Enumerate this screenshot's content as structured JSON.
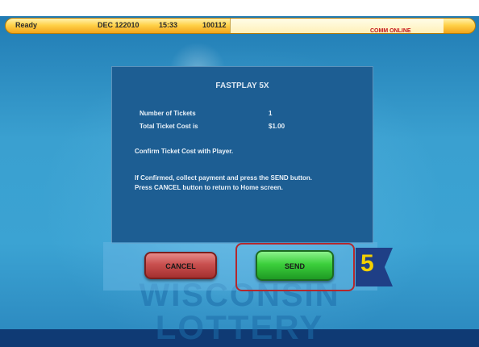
{
  "status_bar": {
    "ready": "Ready",
    "date": "DEC 122010",
    "time": "15:33",
    "code": "100112",
    "comm": "COMM ONLINE"
  },
  "dialog": {
    "title": "FASTPLAY 5X",
    "rows": [
      {
        "label": "Number of Tickets",
        "value": "1"
      },
      {
        "label": "Total Ticket Cost is",
        "value": "$1.00"
      }
    ],
    "confirm": "Confirm Ticket Cost with Player.",
    "instruction_line1": "If Confirmed, collect payment and press the SEND button.",
    "instruction_line2": "Press CANCEL button to return to Home screen."
  },
  "buttons": {
    "cancel": "CANCEL",
    "send": "SEND"
  },
  "step_marker": "5",
  "watermark": {
    "line1": "WISCONSIN",
    "line2": "LOTTERY"
  },
  "colors": {
    "status_bar": "#ffd24a",
    "dialog_bg": "#1d5e93",
    "cancel_button": "#c9504f",
    "send_button": "#3ccf3c",
    "highlight_border": "#b3282d",
    "step_number": "#f4d000"
  }
}
